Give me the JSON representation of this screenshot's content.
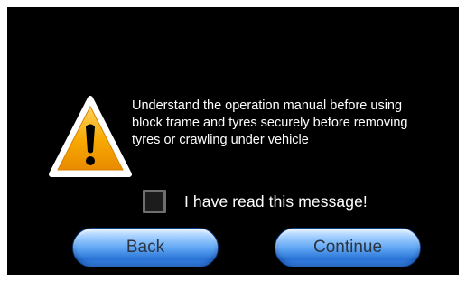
{
  "dialog": {
    "message_lines": [
      "Understand the operation manual before using",
      "block frame and tyres securely before removing",
      "tyres or crawling under vehicle"
    ],
    "acknowledge_label": "I have read this message!",
    "acknowledged": false,
    "warning_icon": "warning-triangle-icon"
  },
  "buttons": {
    "back_label": "Back",
    "continue_label": "Continue"
  },
  "colors": {
    "background": "#000000",
    "text": "#ffffff",
    "warning_fill": "#f6a800",
    "warning_border": "#ffffff",
    "button_blue": "#4a94ee"
  }
}
